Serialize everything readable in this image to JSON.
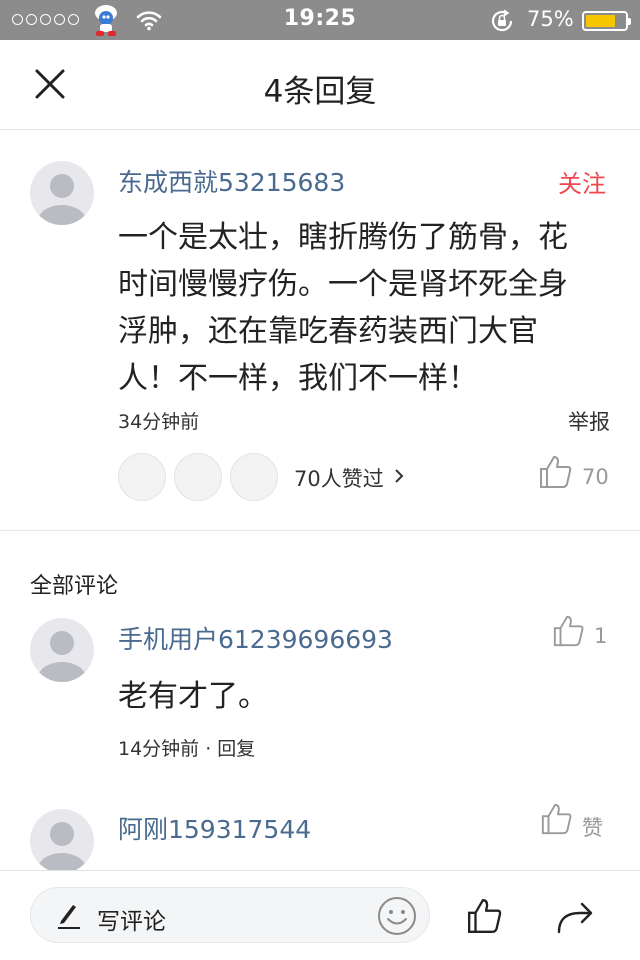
{
  "status_bar": {
    "time": "19:25",
    "battery_percent_label": "75%",
    "battery_level": 0.75
  },
  "header": {
    "title": "4条回复",
    "close_icon": "close-icon"
  },
  "main_comment": {
    "username": "东成西就53215683",
    "follow_label": "关注",
    "content_lines": [
      "一个是太壮，瞎折腾伤了筋骨，花",
      "时间慢慢疗伤。一个是肾坏死全身",
      "浮肿，还在靠吃春药装西门大官",
      "人！不一样，我们不一样！"
    ],
    "time": "34分钟前",
    "report_label": "举报",
    "likers_summary": "70人赞过",
    "like_count": "70"
  },
  "section_title": "全部评论",
  "replies": [
    {
      "username": "手机用户61239696693",
      "content": "老有才了。",
      "meta": "14分钟前 · 回复",
      "like_count": "1"
    },
    {
      "username": "阿刚159317544",
      "content": "",
      "meta": "",
      "like_count": "赞"
    }
  ],
  "bottom_bar": {
    "comment_placeholder": "写评论"
  },
  "colors": {
    "status_bar_bg": "#8c8c8c",
    "username": "#4a6a90",
    "follow": "#f0484f",
    "battery": "#f6c700"
  }
}
